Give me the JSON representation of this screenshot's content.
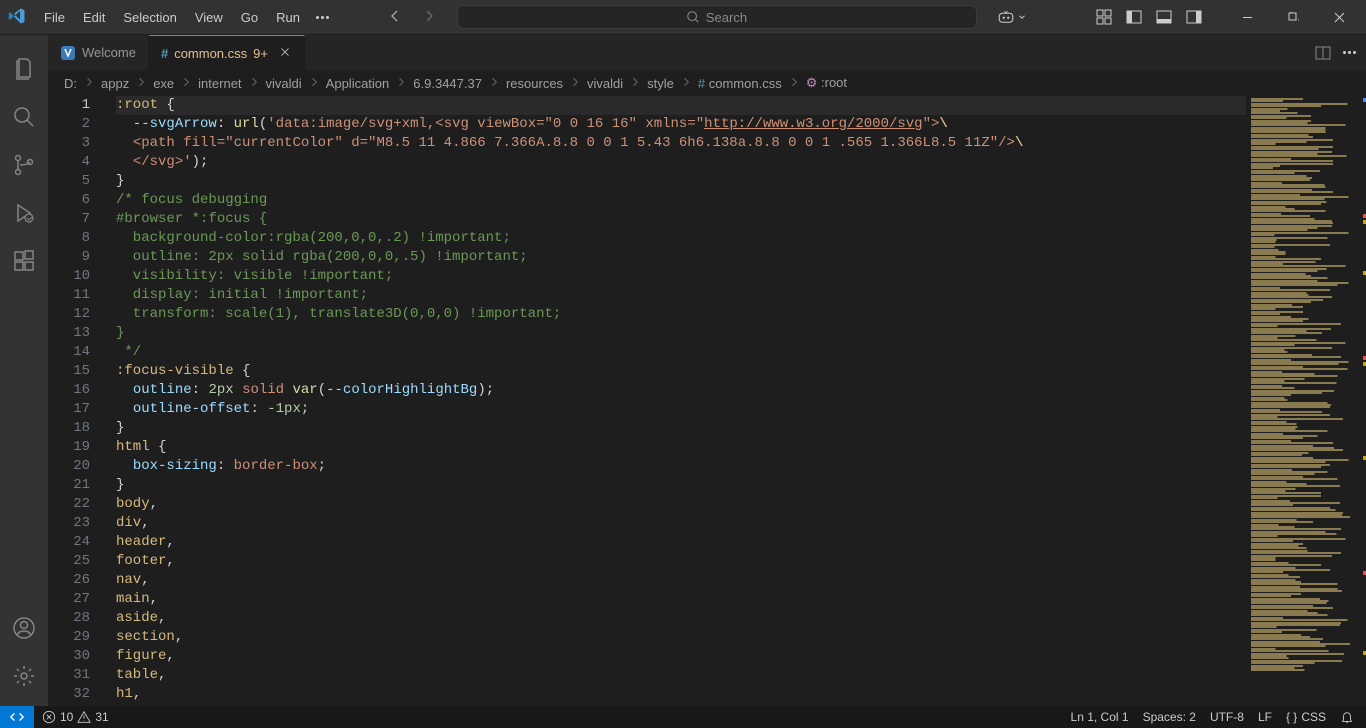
{
  "menu": [
    "File",
    "Edit",
    "Selection",
    "View",
    "Go",
    "Run"
  ],
  "search_placeholder": "Search",
  "tabs": [
    {
      "icon": "vivaldi",
      "label": "Welcome",
      "active": false,
      "dirty": false
    },
    {
      "icon": "hash",
      "label": "common.css",
      "suffix": "9+",
      "active": true,
      "dirty": false
    }
  ],
  "breadcrumbs": [
    "D:",
    "appz",
    "exe",
    "internet",
    "vivaldi",
    "Application",
    "6.9.3447.37",
    "resources",
    "vivaldi",
    "style",
    "common.css",
    ":root"
  ],
  "code_lines": [
    {
      "n": 1,
      "segs": [
        {
          "t": ":root ",
          "c": "tok-selector"
        },
        {
          "t": "{",
          "c": "tok-brace"
        }
      ]
    },
    {
      "n": 2,
      "segs": [
        {
          "t": "  ",
          "c": ""
        },
        {
          "t": "--svgArrow",
          "c": "tok-customprop"
        },
        {
          "t": ": ",
          "c": "tok-punct"
        },
        {
          "t": "url",
          "c": "tok-func"
        },
        {
          "t": "(",
          "c": "tok-punct"
        },
        {
          "t": "'data:image/svg+xml,<svg viewBox=\"0 0 16 16\" xmlns=\"",
          "c": "tok-str"
        },
        {
          "t": "http://www.w3.org/2000/svg",
          "c": "tok-url"
        },
        {
          "t": "\">",
          "c": "tok-str"
        },
        {
          "t": "\\",
          "c": "tok-esc"
        }
      ]
    },
    {
      "n": 3,
      "segs": [
        {
          "t": "  ",
          "c": ""
        },
        {
          "t": "<path fill=\"currentColor\" d=\"M8.5 11 4.866 7.366A.8.8 0 0 1 5.43 6h6.138a.8.8 0 0 1 .565 1.366L8.5 11Z\"/>",
          "c": "tok-str"
        },
        {
          "t": "\\",
          "c": "tok-esc"
        }
      ]
    },
    {
      "n": 4,
      "segs": [
        {
          "t": "  ",
          "c": ""
        },
        {
          "t": "</svg>'",
          "c": "tok-str"
        },
        {
          "t": ")",
          "c": "tok-punct"
        },
        {
          "t": ";",
          "c": "tok-punct"
        }
      ]
    },
    {
      "n": 5,
      "segs": [
        {
          "t": "}",
          "c": "tok-brace"
        }
      ]
    },
    {
      "n": 6,
      "segs": [
        {
          "t": "/* focus debugging",
          "c": "tok-comment"
        }
      ]
    },
    {
      "n": 7,
      "segs": [
        {
          "t": "#browser *:focus {",
          "c": "tok-comment"
        }
      ]
    },
    {
      "n": 8,
      "segs": [
        {
          "t": "  background-color:rgba(200,0,0,.2) !important;",
          "c": "tok-comment"
        }
      ]
    },
    {
      "n": 9,
      "segs": [
        {
          "t": "  outline: 2px solid rgba(200,0,0,.5) !important;",
          "c": "tok-comment"
        }
      ]
    },
    {
      "n": 10,
      "segs": [
        {
          "t": "  visibility: visible !important;",
          "c": "tok-comment"
        }
      ]
    },
    {
      "n": 11,
      "segs": [
        {
          "t": "  display: initial !important;",
          "c": "tok-comment"
        }
      ]
    },
    {
      "n": 12,
      "segs": [
        {
          "t": "  transform: scale(1), translate3D(0,0,0) !important;",
          "c": "tok-comment"
        }
      ]
    },
    {
      "n": 13,
      "segs": [
        {
          "t": "}",
          "c": "tok-comment"
        }
      ]
    },
    {
      "n": 14,
      "segs": [
        {
          "t": " */",
          "c": "tok-comment"
        }
      ]
    },
    {
      "n": 15,
      "segs": [
        {
          "t": ":focus-visible ",
          "c": "tok-selector"
        },
        {
          "t": "{",
          "c": "tok-brace"
        }
      ]
    },
    {
      "n": 16,
      "segs": [
        {
          "t": "  ",
          "c": ""
        },
        {
          "t": "outline",
          "c": "tok-prop"
        },
        {
          "t": ": ",
          "c": "tok-punct"
        },
        {
          "t": "2px",
          "c": "tok-num"
        },
        {
          "t": " ",
          "c": ""
        },
        {
          "t": "solid",
          "c": "tok-keyword"
        },
        {
          "t": " ",
          "c": ""
        },
        {
          "t": "var",
          "c": "tok-func"
        },
        {
          "t": "(",
          "c": "tok-punct"
        },
        {
          "t": "--colorHighlightBg",
          "c": "tok-customprop"
        },
        {
          "t": ")",
          "c": "tok-punct"
        },
        {
          "t": ";",
          "c": "tok-punct"
        }
      ]
    },
    {
      "n": 17,
      "segs": [
        {
          "t": "  ",
          "c": ""
        },
        {
          "t": "outline-offset",
          "c": "tok-prop"
        },
        {
          "t": ": ",
          "c": "tok-punct"
        },
        {
          "t": "-1px",
          "c": "tok-num"
        },
        {
          "t": ";",
          "c": "tok-punct"
        }
      ]
    },
    {
      "n": 18,
      "segs": [
        {
          "t": "}",
          "c": "tok-brace"
        }
      ]
    },
    {
      "n": 19,
      "segs": [
        {
          "t": "html ",
          "c": "tok-selector"
        },
        {
          "t": "{",
          "c": "tok-brace"
        }
      ]
    },
    {
      "n": 20,
      "segs": [
        {
          "t": "  ",
          "c": ""
        },
        {
          "t": "box-sizing",
          "c": "tok-prop"
        },
        {
          "t": ": ",
          "c": "tok-punct"
        },
        {
          "t": "border-box",
          "c": "tok-keyword"
        },
        {
          "t": ";",
          "c": "tok-punct"
        }
      ]
    },
    {
      "n": 21,
      "segs": [
        {
          "t": "}",
          "c": "tok-brace"
        }
      ]
    },
    {
      "n": 22,
      "segs": [
        {
          "t": "body",
          "c": "tok-selector"
        },
        {
          "t": ",",
          "c": "tok-punct"
        }
      ]
    },
    {
      "n": 23,
      "segs": [
        {
          "t": "div",
          "c": "tok-selector"
        },
        {
          "t": ",",
          "c": "tok-punct"
        }
      ]
    },
    {
      "n": 24,
      "segs": [
        {
          "t": "header",
          "c": "tok-selector"
        },
        {
          "t": ",",
          "c": "tok-punct"
        }
      ]
    },
    {
      "n": 25,
      "segs": [
        {
          "t": "footer",
          "c": "tok-selector"
        },
        {
          "t": ",",
          "c": "tok-punct"
        }
      ]
    },
    {
      "n": 26,
      "segs": [
        {
          "t": "nav",
          "c": "tok-selector"
        },
        {
          "t": ",",
          "c": "tok-punct"
        }
      ]
    },
    {
      "n": 27,
      "segs": [
        {
          "t": "main",
          "c": "tok-selector"
        },
        {
          "t": ",",
          "c": "tok-punct"
        }
      ]
    },
    {
      "n": 28,
      "segs": [
        {
          "t": "aside",
          "c": "tok-selector"
        },
        {
          "t": ",",
          "c": "tok-punct"
        }
      ]
    },
    {
      "n": 29,
      "segs": [
        {
          "t": "section",
          "c": "tok-selector"
        },
        {
          "t": ",",
          "c": "tok-punct"
        }
      ]
    },
    {
      "n": 30,
      "segs": [
        {
          "t": "figure",
          "c": "tok-selector"
        },
        {
          "t": ",",
          "c": "tok-punct"
        }
      ]
    },
    {
      "n": 31,
      "segs": [
        {
          "t": "table",
          "c": "tok-selector"
        },
        {
          "t": ",",
          "c": "tok-punct"
        }
      ]
    },
    {
      "n": 32,
      "segs": [
        {
          "t": "h1",
          "c": "tok-selector"
        },
        {
          "t": ",",
          "c": "tok-punct"
        }
      ]
    }
  ],
  "status": {
    "errors": "10",
    "warnings": "31",
    "cursor": "Ln 1, Col 1",
    "spaces": "Spaces: 2",
    "encoding": "UTF-8",
    "eol": "LF",
    "lang_icon": "{ }",
    "lang": "CSS"
  }
}
